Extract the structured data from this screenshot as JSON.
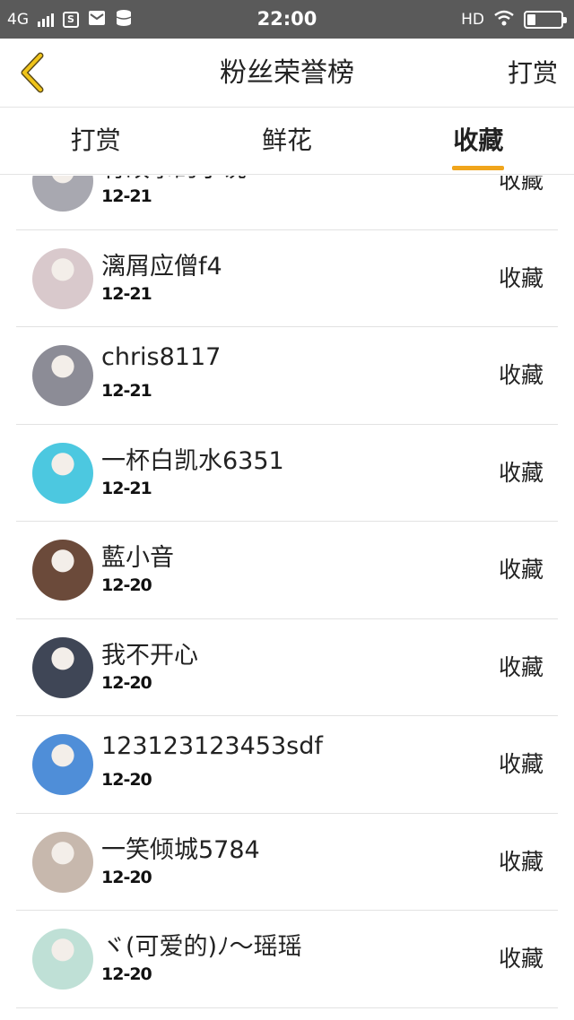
{
  "status_bar": {
    "network": "4G",
    "time": "22:00",
    "hd_label": "HD",
    "icons": [
      "signal-icon",
      "s-app-icon",
      "mail-icon",
      "database-icon",
      "wifi-icon",
      "battery-icon"
    ]
  },
  "header": {
    "back_icon": "chevron-left-icon",
    "title": "粉丝荣誉榜",
    "action_label": "打赏",
    "accent_color": "#f0a51c"
  },
  "tabs": [
    {
      "label": "打赏",
      "active": false
    },
    {
      "label": "鲜花",
      "active": false
    },
    {
      "label": "收藏",
      "active": true
    }
  ],
  "list": {
    "items": [
      {
        "name": "有故事的小说",
        "date": "12-21",
        "action": "收藏",
        "avatar": "#a8a8b0"
      },
      {
        "name": "漓屑应僧f4",
        "date": "12-21",
        "action": "收藏",
        "avatar": "#d9c9cc"
      },
      {
        "name": "chris8117",
        "date": "12-21",
        "action": "收藏",
        "avatar": "#8c8c96"
      },
      {
        "name": "一杯白凯水6351",
        "date": "12-21",
        "action": "收藏",
        "avatar": "#4cc8e0"
      },
      {
        "name": "藍小音",
        "date": "12-20",
        "action": "收藏",
        "avatar": "#6b4a3a"
      },
      {
        "name": "我不开心",
        "date": "12-20",
        "action": "收藏",
        "avatar": "#3f4656"
      },
      {
        "name": "123123123453sdf",
        "date": "12-20",
        "action": "收藏",
        "avatar": "#4f8ed8"
      },
      {
        "name": "一笑倾城5784",
        "date": "12-20",
        "action": "收藏",
        "avatar": "#c7b8ad"
      },
      {
        "name": "ヾ(可爱的)ﾉ〜瑶瑶",
        "date": "12-20",
        "action": "收藏",
        "avatar": "#bfe0d6"
      }
    ]
  }
}
